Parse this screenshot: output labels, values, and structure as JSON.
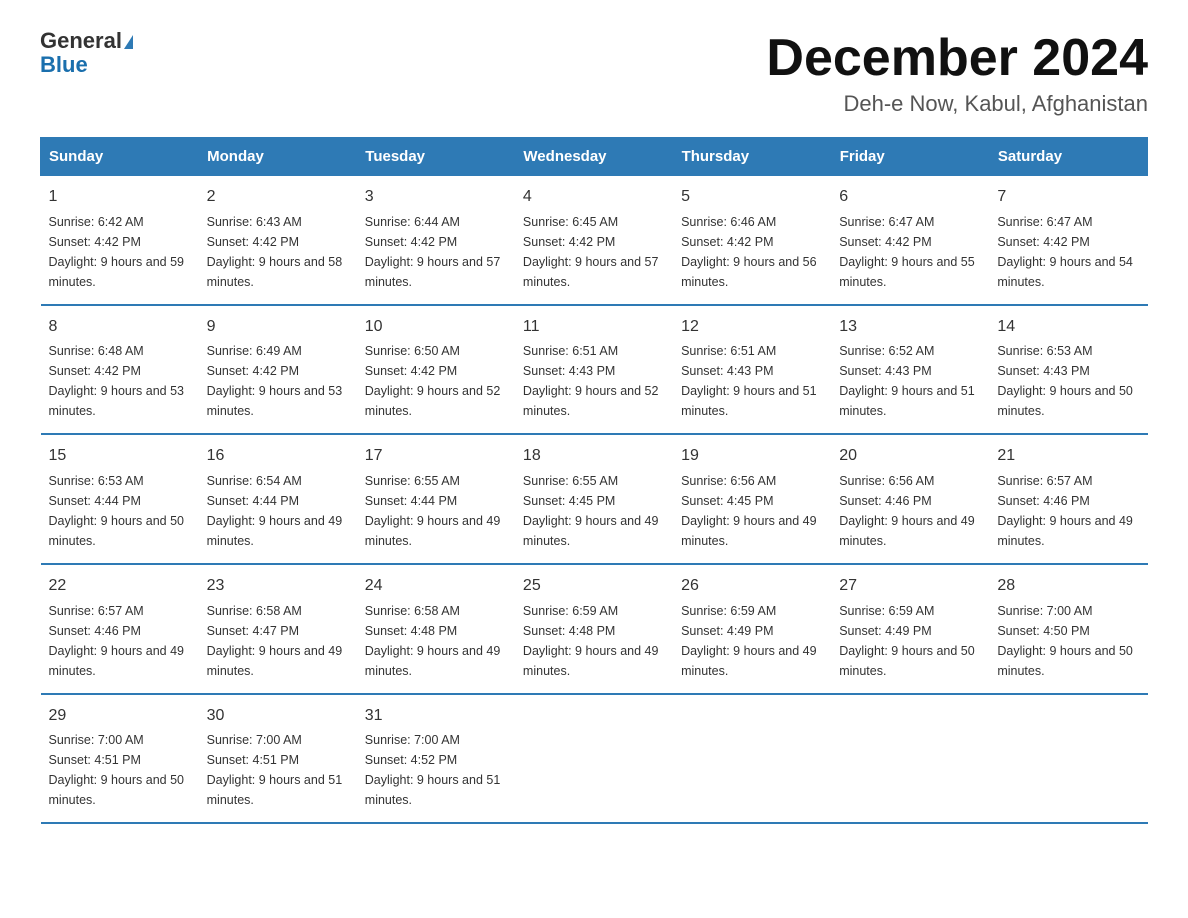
{
  "header": {
    "logo_general": "General",
    "logo_blue": "Blue",
    "month_title": "December 2024",
    "subtitle": "Deh-e Now, Kabul, Afghanistan"
  },
  "days_of_week": [
    "Sunday",
    "Monday",
    "Tuesday",
    "Wednesday",
    "Thursday",
    "Friday",
    "Saturday"
  ],
  "weeks": [
    [
      {
        "day": "1",
        "sunrise": "6:42 AM",
        "sunset": "4:42 PM",
        "daylight": "9 hours and 59 minutes."
      },
      {
        "day": "2",
        "sunrise": "6:43 AM",
        "sunset": "4:42 PM",
        "daylight": "9 hours and 58 minutes."
      },
      {
        "day": "3",
        "sunrise": "6:44 AM",
        "sunset": "4:42 PM",
        "daylight": "9 hours and 57 minutes."
      },
      {
        "day": "4",
        "sunrise": "6:45 AM",
        "sunset": "4:42 PM",
        "daylight": "9 hours and 57 minutes."
      },
      {
        "day": "5",
        "sunrise": "6:46 AM",
        "sunset": "4:42 PM",
        "daylight": "9 hours and 56 minutes."
      },
      {
        "day": "6",
        "sunrise": "6:47 AM",
        "sunset": "4:42 PM",
        "daylight": "9 hours and 55 minutes."
      },
      {
        "day": "7",
        "sunrise": "6:47 AM",
        "sunset": "4:42 PM",
        "daylight": "9 hours and 54 minutes."
      }
    ],
    [
      {
        "day": "8",
        "sunrise": "6:48 AM",
        "sunset": "4:42 PM",
        "daylight": "9 hours and 53 minutes."
      },
      {
        "day": "9",
        "sunrise": "6:49 AM",
        "sunset": "4:42 PM",
        "daylight": "9 hours and 53 minutes."
      },
      {
        "day": "10",
        "sunrise": "6:50 AM",
        "sunset": "4:42 PM",
        "daylight": "9 hours and 52 minutes."
      },
      {
        "day": "11",
        "sunrise": "6:51 AM",
        "sunset": "4:43 PM",
        "daylight": "9 hours and 52 minutes."
      },
      {
        "day": "12",
        "sunrise": "6:51 AM",
        "sunset": "4:43 PM",
        "daylight": "9 hours and 51 minutes."
      },
      {
        "day": "13",
        "sunrise": "6:52 AM",
        "sunset": "4:43 PM",
        "daylight": "9 hours and 51 minutes."
      },
      {
        "day": "14",
        "sunrise": "6:53 AM",
        "sunset": "4:43 PM",
        "daylight": "9 hours and 50 minutes."
      }
    ],
    [
      {
        "day": "15",
        "sunrise": "6:53 AM",
        "sunset": "4:44 PM",
        "daylight": "9 hours and 50 minutes."
      },
      {
        "day": "16",
        "sunrise": "6:54 AM",
        "sunset": "4:44 PM",
        "daylight": "9 hours and 49 minutes."
      },
      {
        "day": "17",
        "sunrise": "6:55 AM",
        "sunset": "4:44 PM",
        "daylight": "9 hours and 49 minutes."
      },
      {
        "day": "18",
        "sunrise": "6:55 AM",
        "sunset": "4:45 PM",
        "daylight": "9 hours and 49 minutes."
      },
      {
        "day": "19",
        "sunrise": "6:56 AM",
        "sunset": "4:45 PM",
        "daylight": "9 hours and 49 minutes."
      },
      {
        "day": "20",
        "sunrise": "6:56 AM",
        "sunset": "4:46 PM",
        "daylight": "9 hours and 49 minutes."
      },
      {
        "day": "21",
        "sunrise": "6:57 AM",
        "sunset": "4:46 PM",
        "daylight": "9 hours and 49 minutes."
      }
    ],
    [
      {
        "day": "22",
        "sunrise": "6:57 AM",
        "sunset": "4:46 PM",
        "daylight": "9 hours and 49 minutes."
      },
      {
        "day": "23",
        "sunrise": "6:58 AM",
        "sunset": "4:47 PM",
        "daylight": "9 hours and 49 minutes."
      },
      {
        "day": "24",
        "sunrise": "6:58 AM",
        "sunset": "4:48 PM",
        "daylight": "9 hours and 49 minutes."
      },
      {
        "day": "25",
        "sunrise": "6:59 AM",
        "sunset": "4:48 PM",
        "daylight": "9 hours and 49 minutes."
      },
      {
        "day": "26",
        "sunrise": "6:59 AM",
        "sunset": "4:49 PM",
        "daylight": "9 hours and 49 minutes."
      },
      {
        "day": "27",
        "sunrise": "6:59 AM",
        "sunset": "4:49 PM",
        "daylight": "9 hours and 50 minutes."
      },
      {
        "day": "28",
        "sunrise": "7:00 AM",
        "sunset": "4:50 PM",
        "daylight": "9 hours and 50 minutes."
      }
    ],
    [
      {
        "day": "29",
        "sunrise": "7:00 AM",
        "sunset": "4:51 PM",
        "daylight": "9 hours and 50 minutes."
      },
      {
        "day": "30",
        "sunrise": "7:00 AM",
        "sunset": "4:51 PM",
        "daylight": "9 hours and 51 minutes."
      },
      {
        "day": "31",
        "sunrise": "7:00 AM",
        "sunset": "4:52 PM",
        "daylight": "9 hours and 51 minutes."
      },
      null,
      null,
      null,
      null
    ]
  ],
  "labels": {
    "sunrise": "Sunrise: ",
    "sunset": "Sunset: ",
    "daylight": "Daylight: "
  }
}
